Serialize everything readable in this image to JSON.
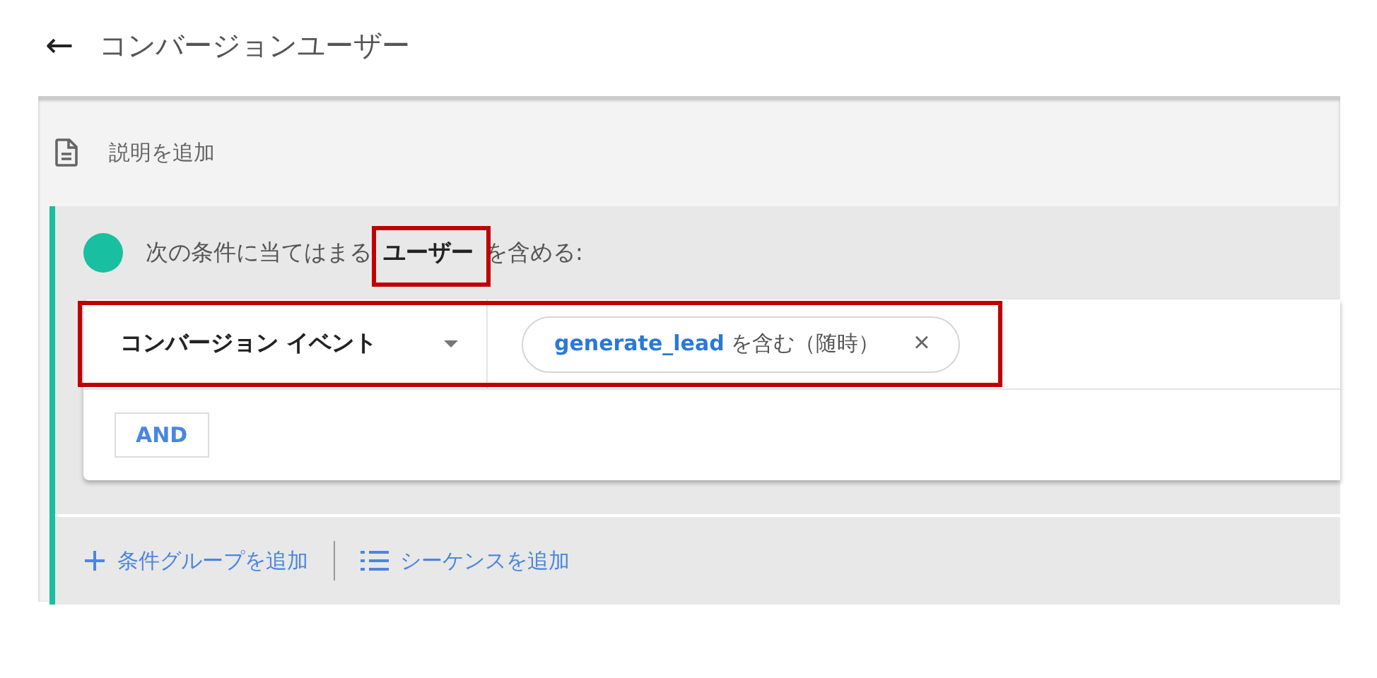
{
  "header": {
    "back": "←",
    "title": "コンバージョンユーザー"
  },
  "description": {
    "label": "説明を追加"
  },
  "group": {
    "text_before": "次の条件に当てはまる",
    "subject": "ユーザー",
    "subject_highlighted": true,
    "text_after": "を含める:",
    "conditions": [
      {
        "field": "コンバージョン イベント",
        "value": "**generate_lead** を含む（随時）",
        "remove": "×",
        "highlighted": true
      }
    ],
    "and_button": "AND"
  },
  "footer": {
    "actions": [
      {
        "kind": "add",
        "label": "条件グループを追加"
      },
      {
        "kind": "sequence",
        "label": "シーケンスを追加"
      }
    ]
  }
}
